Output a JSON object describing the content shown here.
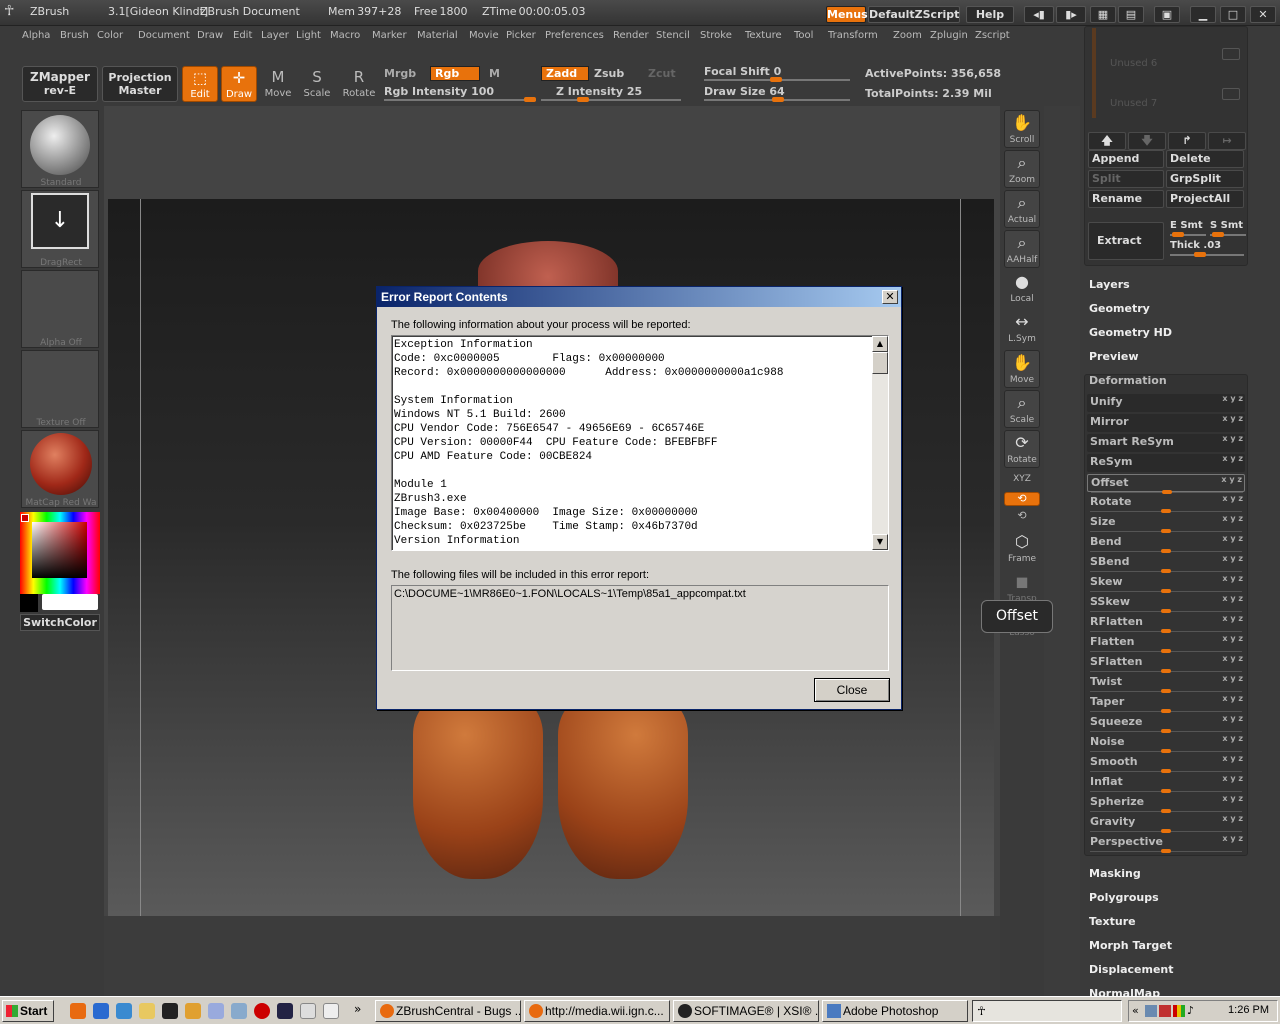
{
  "titlebar": {
    "app": "ZBrush",
    "version": "3.1[Gideon Klindt]",
    "document": "ZBrush Document",
    "mem": "Mem 397+28",
    "free": "Free 1800",
    "ztime": "ZTime 00:00:05.03",
    "menus": "Menus",
    "script": "DefaultZScript",
    "help": "Help"
  },
  "menubar": [
    "Alpha",
    "Brush",
    "Color",
    "Document",
    "Draw",
    "Edit",
    "Layer",
    "Light",
    "Macro",
    "Marker",
    "Material",
    "Movie",
    "Picker",
    "Preferences",
    "Render",
    "Stencil",
    "Stroke",
    "Texture",
    "Tool",
    "Transform",
    "Zoom",
    "Zplugin",
    "Zscript"
  ],
  "shelf": {
    "zmapper": "ZMapper",
    "zmapper_sub": "rev-E",
    "projection": "Projection",
    "projection_sub": "Master",
    "tools": [
      "Edit",
      "Draw",
      "Move",
      "Scale",
      "Rotate"
    ],
    "mrgb": "Mrgb",
    "rgb": "Rgb",
    "m": "M",
    "zadd": "Zadd",
    "zsub": "Zsub",
    "zcut": "Zcut",
    "rgb_intensity": "Rgb Intensity 100",
    "z_intensity": "Z Intensity 25",
    "focal_shift": "Focal Shift 0",
    "draw_size": "Draw Size 64",
    "active_points": "ActivePoints: 356,658",
    "total_points": "TotalPoints: 2.39 Mil"
  },
  "left": {
    "thumbs": [
      "Standard",
      "DragRect",
      "Alpha Off",
      "Texture Off",
      "MatCap Red Wa"
    ],
    "switch": "SwitchColor"
  },
  "right_tools": [
    "Scroll",
    "Zoom",
    "Actual",
    "AAHalf",
    "Local",
    "L.Sym",
    "Move",
    "Scale",
    "Rotate",
    "XYZ",
    "",
    "",
    "Frame",
    "Transp",
    "Lasso"
  ],
  "rpanel": {
    "unused": [
      "Unused 6",
      "Unused 7"
    ],
    "buttons": [
      "Append",
      "Delete",
      "Split",
      "GrpSplit",
      "Rename",
      "ProjectAll",
      "Extract"
    ],
    "e_smt": "E Smt",
    "s_smt": "S Smt",
    "thick": "Thick .03",
    "sections_top": [
      "Layers",
      "Geometry",
      "Geometry HD",
      "Preview"
    ],
    "deformation": "Deformation",
    "def_buttons": [
      "Unify",
      "Mirror",
      "Smart ReSym",
      "ReSym"
    ],
    "def_sliders": [
      "Offset",
      "Rotate",
      "Size",
      "Bend",
      "SBend",
      "Skew",
      "SSkew",
      "RFlatten",
      "Flatten",
      "SFlatten",
      "Twist",
      "Taper",
      "Squeeze",
      "Noise",
      "Smooth",
      "Inflat",
      "Spherize",
      "Gravity",
      "Perspective"
    ],
    "sections_bottom": [
      "Masking",
      "Polygroups",
      "Texture",
      "Morph Target",
      "Displacement",
      "NormalMap"
    ]
  },
  "tooltip": "Offset",
  "dialog": {
    "title": "Error Report Contents",
    "intro": "The following information about your process will be reported:",
    "report": "Exception Information\nCode: 0xc0000005        Flags: 0x00000000\nRecord: 0x0000000000000000      Address: 0x0000000000a1c988\n\nSystem Information\nWindows NT 5.1 Build: 2600\nCPU Vendor Code: 756E6547 - 49656E69 - 6C65746E\nCPU Version: 00000F44  CPU Feature Code: BFEBFBFF\nCPU AMD Feature Code: 00CBE824\n\nModule 1\nZBrush3.exe\nImage Base: 0x00400000  Image Size: 0x00000000\nChecksum: 0x023725be    Time Stamp: 0x46b7370d\nVersion Information",
    "files_intro": "The following files will be included in this error report:",
    "file": "C:\\DOCUME~1\\MR86E0~1.FON\\LOCALS~1\\Temp\\85a1_appcompat.txt",
    "close": "Close"
  },
  "taskbar": {
    "start": "Start",
    "chevron": "»",
    "tasks": [
      "ZBrushCentral - Bugs ...",
      "http://media.wii.ign.c...",
      "SOFTIMAGE® | XSI® ...",
      "Adobe Photoshop"
    ],
    "tray_chevron": "«",
    "clock": "1:26 PM"
  },
  "colors": {
    "accent": "#e8720c",
    "panel": "#3a3a3a",
    "xp_blue": "#0a246a"
  }
}
